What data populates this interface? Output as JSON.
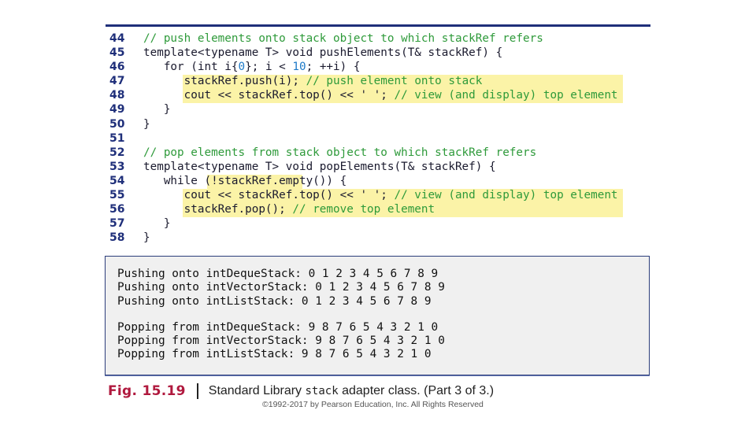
{
  "colors": {
    "rule": "#1f2f7a",
    "line_number": "#1f2f7a",
    "comment": "#2e9a3a",
    "highlight": "#fbf3a7",
    "output_bg": "#f0f0f0",
    "fig_label": "#b0193e"
  },
  "code": {
    "lines": [
      {
        "num": "44",
        "segments": [
          {
            "t": "// push elements onto stack object to which stackRef refers",
            "c": "com"
          }
        ]
      },
      {
        "num": "45",
        "segments": [
          {
            "t": "template<typename T> void pushElements(T& stackRef) {",
            "c": "txt"
          }
        ]
      },
      {
        "num": "46",
        "segments": [
          {
            "t": "   for (int i{",
            "c": "txt"
          },
          {
            "t": "0",
            "c": "num"
          },
          {
            "t": "}; i < ",
            "c": "txt"
          },
          {
            "t": "10",
            "c": "num"
          },
          {
            "t": "; ++i) {",
            "c": "txt"
          }
        ]
      },
      {
        "num": "47",
        "segments": [
          {
            "t": "      stackRef.push(i); ",
            "c": "txt"
          },
          {
            "t": "// push element onto stack",
            "c": "com"
          }
        ]
      },
      {
        "num": "48",
        "segments": [
          {
            "t": "      cout << stackRef.top() << ' '; ",
            "c": "txt"
          },
          {
            "t": "// view (and display) top element",
            "c": "com"
          }
        ]
      },
      {
        "num": "49",
        "segments": [
          {
            "t": "   }",
            "c": "txt"
          }
        ]
      },
      {
        "num": "50",
        "segments": [
          {
            "t": "}",
            "c": "txt"
          }
        ]
      },
      {
        "num": "51",
        "segments": [
          {
            "t": "",
            "c": "txt"
          }
        ]
      },
      {
        "num": "52",
        "segments": [
          {
            "t": "// pop elements from stack object to which stackRef refers",
            "c": "com"
          }
        ]
      },
      {
        "num": "53",
        "segments": [
          {
            "t": "template<typename T> void popElements(T& stackRef) {",
            "c": "txt"
          }
        ]
      },
      {
        "num": "54",
        "segments": [
          {
            "t": "   while (!stackRef.empty()) {",
            "c": "txt"
          }
        ]
      },
      {
        "num": "55",
        "segments": [
          {
            "t": "      cout << stackRef.top() << ' '; ",
            "c": "txt"
          },
          {
            "t": "// view (and display) top element",
            "c": "com"
          }
        ]
      },
      {
        "num": "56",
        "segments": [
          {
            "t": "      stackRef.pop(); ",
            "c": "txt"
          },
          {
            "t": "// remove top element",
            "c": "com"
          }
        ]
      },
      {
        "num": "57",
        "segments": [
          {
            "t": "   }",
            "c": "txt"
          }
        ]
      },
      {
        "num": "58",
        "segments": [
          {
            "t": "}",
            "c": "txt"
          }
        ]
      }
    ]
  },
  "output": {
    "push_lines": [
      "Pushing onto intDequeStack: 0 1 2 3 4 5 6 7 8 9",
      "Pushing onto intVectorStack: 0 1 2 3 4 5 6 7 8 9",
      "Pushing onto intListStack: 0 1 2 3 4 5 6 7 8 9"
    ],
    "pop_lines": [
      "Popping from intDequeStack: 9 8 7 6 5 4 3 2 1 0",
      "Popping from intVectorStack: 9 8 7 6 5 4 3 2 1 0",
      "Popping from intListStack: 9 8 7 6 5 4 3 2 1 0"
    ]
  },
  "caption": {
    "fig_label": "Fig. 15.19",
    "text_before": "Standard Library ",
    "code_word": "stack",
    "text_after": " adapter class. (Part 3 of 3.)"
  },
  "copyright": "©1992-2017 by Pearson Education, Inc. All Rights Reserved"
}
